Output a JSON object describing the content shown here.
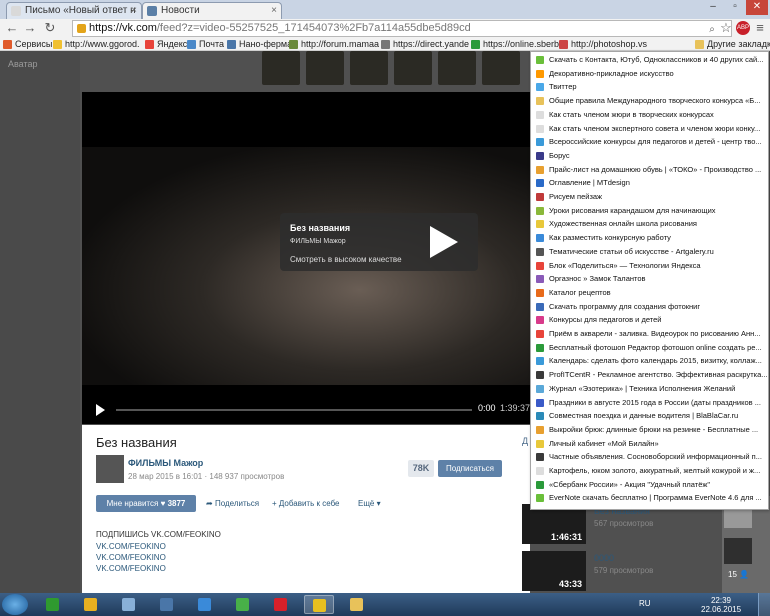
{
  "browser": {
    "tabs": [
      {
        "label": "Письмо «Новый ответ н",
        "favicon_color": "#d9d9d9"
      },
      {
        "label": "Новости",
        "favicon_color": "#5b7fa6"
      }
    ],
    "url_host": "https://vk.com",
    "url_path": "/feed?z=video-55257525_171454073%2Fb7a114a55dbe5d89cd",
    "bookmarks": [
      {
        "label": "Сервисы",
        "color": "#e05a2a"
      },
      {
        "label": "http://www.ggorod.",
        "color": "#f0c030"
      },
      {
        "label": "Яндекс",
        "color": "#e8443a"
      },
      {
        "label": "Почта",
        "color": "#4a88c8"
      },
      {
        "label": "Нано-ферма",
        "color": "#4a76a8"
      },
      {
        "label": "http://forum.mamaa",
        "color": "#6a8a3a"
      },
      {
        "label": "https://direct.yande",
        "color": "#777777"
      },
      {
        "label": "https://online.sberb",
        "color": "#2a9a3a"
      },
      {
        "label": "http://photoshop.vs",
        "color": "#c44"
      },
      {
        "label": "Другие закладки",
        "color": "#e8c25a"
      }
    ]
  },
  "sidebar": {
    "label": "Аватар"
  },
  "player": {
    "overlay_title": "Без названия",
    "overlay_channel": "ФИЛЬМЫ Мажор",
    "overlay_hq": "Смотреть в высоком качестве",
    "time_current": "0:00",
    "time_total": "1:39:37"
  },
  "video_info": {
    "title": "Без названия",
    "owner": "ФИЛЬМЫ Мажор",
    "meta": "28 мар 2015 в 16:01  ·  148 937 просмотров",
    "subscribers": "78K",
    "subscribe_label": "Подписаться",
    "like_label": "Мне нравится",
    "like_count": "3877",
    "share_label": "Поделиться",
    "add_label": "Добавить к себе",
    "more_label": "Ещё",
    "desc_lines": [
      "ПОДПИШИСЬ VK.COM/FEOKINO",
      "VK.COM/FEOKINO",
      "VK.COM/FEOKINO",
      "VK.COM/FEOKINO"
    ]
  },
  "related": {
    "header": "Д",
    "items": [
      {
        "title": "Без названия",
        "views": "567 просмотров",
        "duration": "1:46:31"
      },
      {
        "title": "0000",
        "views": "579 просмотров",
        "duration": "43:33"
      }
    ],
    "strip_count": "15 👤"
  },
  "other_bookmarks": [
    {
      "label": "Скачать с Контакта, Ютуб, Одноклассников и 40 других сай...",
      "color": "#6abf3a"
    },
    {
      "label": "Декоративно-прикладное искусство",
      "color": "#ff9900"
    },
    {
      "label": "Твиттер",
      "color": "#4aa8e8"
    },
    {
      "label": "Общие правила Международного творческого конкурса «Б...",
      "color": "#e8c25a"
    },
    {
      "label": "Как стать членом жюри в творческих конкурсах",
      "color": "#dddddd"
    },
    {
      "label": "Как стать членом экспертного совета и членом жюри конку...",
      "color": "#dddddd"
    },
    {
      "label": "Всероссийские конкурсы для педагогов и детей - центр тво...",
      "color": "#3a9ad9"
    },
    {
      "label": "Борус",
      "color": "#3a3a8a"
    },
    {
      "label": "Прайс-лист на домашнюю обувь | «ТОКО» - Производство ...",
      "color": "#e8a030"
    },
    {
      "label": "Оглавление | MTdesign",
      "color": "#2a6ac8"
    },
    {
      "label": "Рисуем пейзаж",
      "color": "#c03a3a"
    },
    {
      "label": "Уроки рисования карандашом для начинающих",
      "color": "#8ab83a"
    },
    {
      "label": "Художественная онлайн школа рисования",
      "color": "#e8c83a"
    },
    {
      "label": "Как разместить конкурсную работу",
      "color": "#3a8ad9"
    },
    {
      "label": "Тематические статьи об искусстве - Artgalery.ru",
      "color": "#555555"
    },
    {
      "label": "Блок «Поделиться» — Технологии Яндекса",
      "color": "#e8443a"
    },
    {
      "label": "Оргазнос » Замок Талантов",
      "color": "#8a5ab8"
    },
    {
      "label": "Каталог рецептов",
      "color": "#e86a1a"
    },
    {
      "label": "Скачать программу для создания фотокниг",
      "color": "#3a6ab8"
    },
    {
      "label": "Конкурсы для педагогов и детей",
      "color": "#d83a8a"
    },
    {
      "label": "Приём в акварели - заливка. Видеоурок по рисованию Анн...",
      "color": "#e8443a"
    },
    {
      "label": "Бесплатный фотошоп Редактор фотошоп online создать ре...",
      "color": "#2a9a3a"
    },
    {
      "label": "Календарь: сделать фото календарь 2015, визитку, коллаж...",
      "color": "#3a9ad9"
    },
    {
      "label": "ProfITCentR - Рекламное агентство. Эффективная раскрутка...",
      "color": "#3a3a3a"
    },
    {
      "label": "Журнал «Эзотерика» | Техника Исполнения Желаний",
      "color": "#5aa8d8"
    },
    {
      "label": "Праздники в августе 2015 года в России (даты праздников ...",
      "color": "#3a5ac8"
    },
    {
      "label": "Совместная поездка и данные водителя | BlaBlaCar.ru",
      "color": "#2a8ab8"
    },
    {
      "label": "Выкройки брюк: длинные брюки на резинке - Бесплатные ...",
      "color": "#e8a030"
    },
    {
      "label": "Личный кабинет «Мой Билайн»",
      "color": "#e8c83a"
    },
    {
      "label": "Частные объявления. Сосновоборский информационный п...",
      "color": "#3a3a3a"
    },
    {
      "label": "Картофель, юком золото, аккуратный, желтый кожурой и ж...",
      "color": "#dddddd"
    },
    {
      "label": "«Сбербанк России» - Акция \"Удачный платёж\"",
      "color": "#2a9a3a"
    },
    {
      "label": "EverNote скачать бесплатно | Программа EverNote 4.6 для ...",
      "color": "#6abf3a"
    }
  ],
  "taskbar": {
    "apps": [
      {
        "name": "snake-app-icon",
        "color": "#2f9a2f",
        "active": false
      },
      {
        "name": "media-app-icon",
        "color": "#e8b020",
        "active": false
      },
      {
        "name": "calculator-app-icon",
        "color": "#88b0d8",
        "active": false
      },
      {
        "name": "vk-app-icon",
        "color": "#4a76a8",
        "active": false
      },
      {
        "name": "browser-app-icon",
        "color": "#3a8ad9",
        "active": false
      },
      {
        "name": "torrent-app-icon",
        "color": "#48b048",
        "active": false
      },
      {
        "name": "opera-app-icon",
        "color": "#d8202a",
        "active": false
      },
      {
        "name": "chrome-app-icon",
        "color": "#e8c020",
        "active": true
      },
      {
        "name": "folder-app-icon",
        "color": "#e8c25a",
        "active": false
      }
    ],
    "lang": "RU",
    "time": "22:39",
    "date": "22.06.2015"
  }
}
